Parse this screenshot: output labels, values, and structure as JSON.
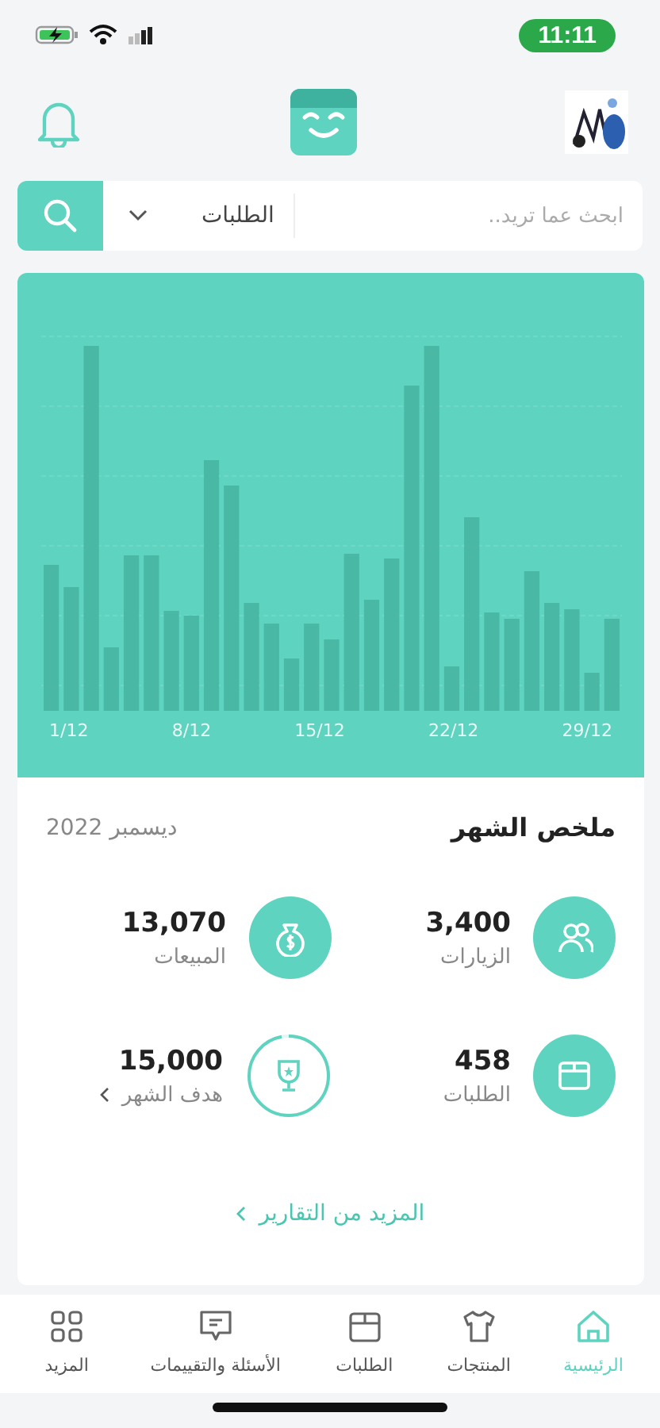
{
  "status_bar": {
    "time": "11:11"
  },
  "search": {
    "placeholder": "ابحث عما تريد..",
    "scope": "الطلبات"
  },
  "chart": {
    "x_labels": [
      "29/12",
      "22/12",
      "15/12",
      "8/12",
      "1/12"
    ]
  },
  "summary": {
    "title": "ملخص الشهر",
    "period": "ديسمبر 2022",
    "stats": [
      {
        "kind": "visits",
        "value": "3,400",
        "label": "الزيارات"
      },
      {
        "kind": "sales",
        "value": "13,070",
        "label": "المبيعات"
      },
      {
        "kind": "orders",
        "value": "458",
        "label": "الطلبات"
      },
      {
        "kind": "goal",
        "value": "15,000",
        "label": "هدف الشهر"
      }
    ],
    "more_link": "المزيد من التقارير"
  },
  "nav": [
    {
      "kind": "home",
      "label": "الرئيسية",
      "selected": true
    },
    {
      "kind": "products",
      "label": "المنتجات",
      "selected": false
    },
    {
      "kind": "orders",
      "label": "الطلبات",
      "selected": false
    },
    {
      "kind": "reviews",
      "label": "الأسئلة والتقييمات",
      "selected": false
    },
    {
      "kind": "more",
      "label": "المزيد",
      "selected": false
    }
  ]
}
